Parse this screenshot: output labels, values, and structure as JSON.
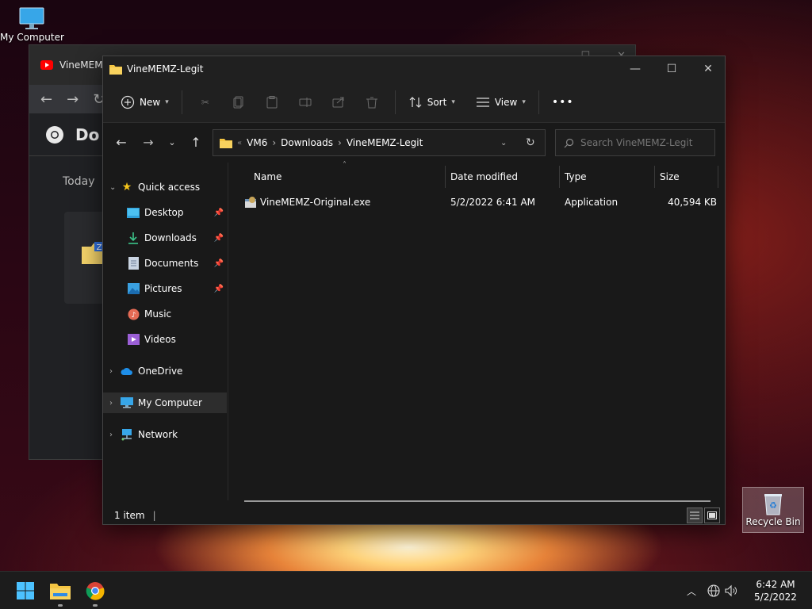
{
  "desktop": {
    "icons": [
      {
        "label": "My Computer",
        "icon": "monitor-icon"
      },
      {
        "label": "Recycle Bin",
        "icon": "recycle-bin-icon"
      }
    ]
  },
  "chrome_window": {
    "tab_title": "VineMEMZ",
    "header_title": "Do",
    "section_label": "Today"
  },
  "explorer": {
    "title": "VineMEMZ-Legit",
    "commands": {
      "new": "New",
      "sort": "Sort",
      "view": "View",
      "more": "•••"
    },
    "address": {
      "overflow": "«",
      "crumbs": [
        "VM6",
        "Downloads",
        "VineMEMZ-Legit"
      ]
    },
    "search_placeholder": "Search VineMEMZ-Legit",
    "nav_pane": {
      "quick_access": "Quick access",
      "pinned": [
        {
          "label": "Desktop",
          "icon": "desktop-folder-icon",
          "pinned": true
        },
        {
          "label": "Downloads",
          "icon": "downloads-icon",
          "pinned": true
        },
        {
          "label": "Documents",
          "icon": "documents-icon",
          "pinned": true
        },
        {
          "label": "Pictures",
          "icon": "pictures-icon",
          "pinned": true
        },
        {
          "label": "Music",
          "icon": "music-icon",
          "pinned": false
        },
        {
          "label": "Videos",
          "icon": "videos-icon",
          "pinned": false
        }
      ],
      "onedrive": "OneDrive",
      "my_computer": "My Computer",
      "network": "Network"
    },
    "columns": {
      "name": "Name",
      "date": "Date modified",
      "type": "Type",
      "size": "Size"
    },
    "files": [
      {
        "name": "VineMEMZ-Original.exe",
        "date": "5/2/2022 6:41 AM",
        "type": "Application",
        "size": "40,594 KB"
      }
    ],
    "status": "1 item"
  },
  "taskbar": {
    "time": "6:42 AM",
    "date": "5/2/2022"
  },
  "colors": {
    "accent": "#0a84ff",
    "folder": "#f4c542"
  }
}
